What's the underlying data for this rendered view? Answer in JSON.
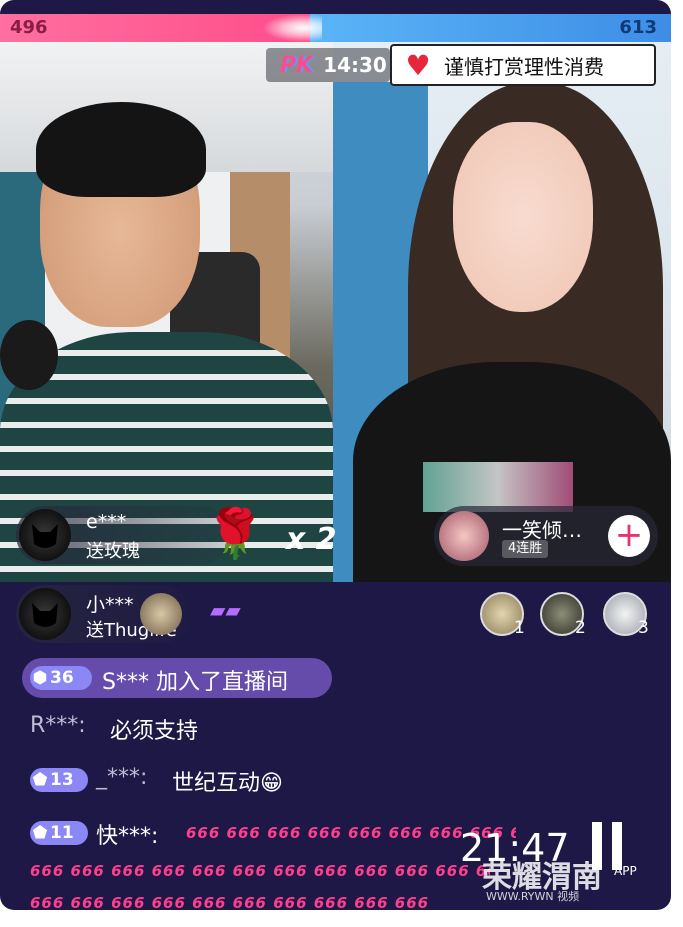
{
  "pk": {
    "left_score": "496",
    "right_score": "613",
    "logo": "PK",
    "timer": "14:30",
    "notice": "谨慎打赏理性消费"
  },
  "gifts": [
    {
      "user": "e***",
      "action": "送玫瑰",
      "multiplier": "x 2"
    },
    {
      "user": "小***",
      "action": "送Thuglife"
    }
  ],
  "opponent": {
    "name": "一笑倾…",
    "streak": "4连胜",
    "follow_symbol": "+"
  },
  "ranking": [
    "1",
    "2",
    "3"
  ],
  "chat": {
    "enter": {
      "level": "36",
      "text": "S*** 加入了直播间"
    },
    "messages": [
      {
        "name": "R***:",
        "text": "必须支持"
      },
      {
        "level": "13",
        "name": "_***:",
        "text": "世纪互动😁"
      },
      {
        "level": "11",
        "name": "快***:",
        "text": "666 666 666 666 666 666 666 666 666 666 666 666"
      }
    ],
    "spam_lines": [
      "666 666 666 666 666 666 666 666 666 666 666 666 666 666",
      "666 666 666 666 666 666 666 666 666 666 666 666 666 666"
    ]
  },
  "overlay": {
    "clock": "21:47",
    "watermark": "荣耀渭南",
    "watermark_sub": "WWW.RYWN   视频",
    "app": "APP"
  },
  "colors": {
    "pk_pink": "#ff4d8a",
    "pk_blue": "#3d8de6",
    "chat_bg": "#1d1846",
    "spam": "#ff3f8e"
  }
}
